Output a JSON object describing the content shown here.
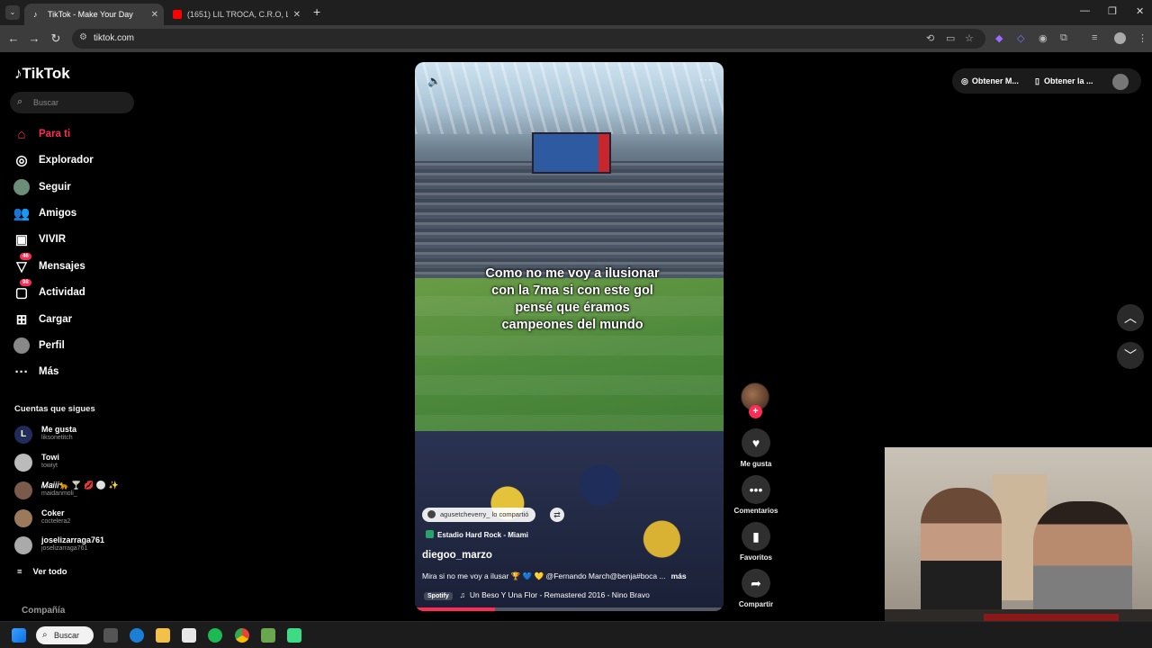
{
  "browser": {
    "tabs": [
      {
        "title": "TikTok - Make Your Day",
        "active": true,
        "icon": "tiktok-icon"
      },
      {
        "title": "(1651) LIL TROCA, C.R.O, LUCH",
        "active": false,
        "icon": "youtube-icon"
      }
    ],
    "url": "tiktok.com"
  },
  "sidebar": {
    "logo": "TikTok",
    "search_placeholder": "Buscar",
    "nav": [
      {
        "label": "Para ti",
        "icon": "home-icon",
        "active": true
      },
      {
        "label": "Explorador",
        "icon": "compass-icon"
      },
      {
        "label": "Seguir",
        "icon": "avatar-icon"
      },
      {
        "label": "Amigos",
        "icon": "friends-icon"
      },
      {
        "label": "VIVIR",
        "icon": "live-icon"
      },
      {
        "label": "Mensajes",
        "icon": "messages-icon",
        "badge": "46"
      },
      {
        "label": "Actividad",
        "icon": "activity-icon",
        "badge": "98"
      },
      {
        "label": "Cargar",
        "icon": "upload-icon"
      },
      {
        "label": "Perfil",
        "icon": "profile-icon"
      },
      {
        "label": "Más",
        "icon": "more-icon"
      }
    ],
    "following_header": "Cuentas que sigues",
    "accounts": [
      {
        "name": "Me gusta",
        "username": "liksonetitch"
      },
      {
        "name": "Towi",
        "username": "towiyt"
      },
      {
        "name": "𝑀𝑎𝑖𝑖𝑖🐆 🍸 💋 ⚪ ✨",
        "username": "maidanmoli_"
      },
      {
        "name": "Coker",
        "username": "coctelera2"
      },
      {
        "name": "joselizarraga761",
        "username": "joselizarraga761"
      }
    ],
    "see_all": "Ver todo",
    "company": "Compañía"
  },
  "video": {
    "caption": "Como no me voy a ilusionar con la 7ma si con este gol pensé que éramos campeones del mundo",
    "shared_by": "agusetcheverry_ lo compartió",
    "location": "Estadio Hard Rock - Miami",
    "author": "diegoo_marzo",
    "description": "Mira si no me voy a ilusar 🏆 💙 💛 @Fernando March@benja#boca ...",
    "more": "más",
    "music_source": "Spotify",
    "music": "Un Beso Y Una Flor - Remastered 2016 - Nino Bravo",
    "progress": 0.26
  },
  "actions": [
    {
      "label": "Me gusta",
      "icon": "heart-icon"
    },
    {
      "label": "Comentarios",
      "icon": "comment-icon"
    },
    {
      "label": "Favoritos",
      "icon": "bookmark-icon"
    },
    {
      "label": "Compartir",
      "icon": "share-icon"
    }
  ],
  "topright": {
    "get_app_1": "Obtener M...",
    "get_app_2": "Obtener la ..."
  },
  "taskbar": {
    "search": "Buscar"
  },
  "colors": {
    "accent": "#fe2c55"
  }
}
